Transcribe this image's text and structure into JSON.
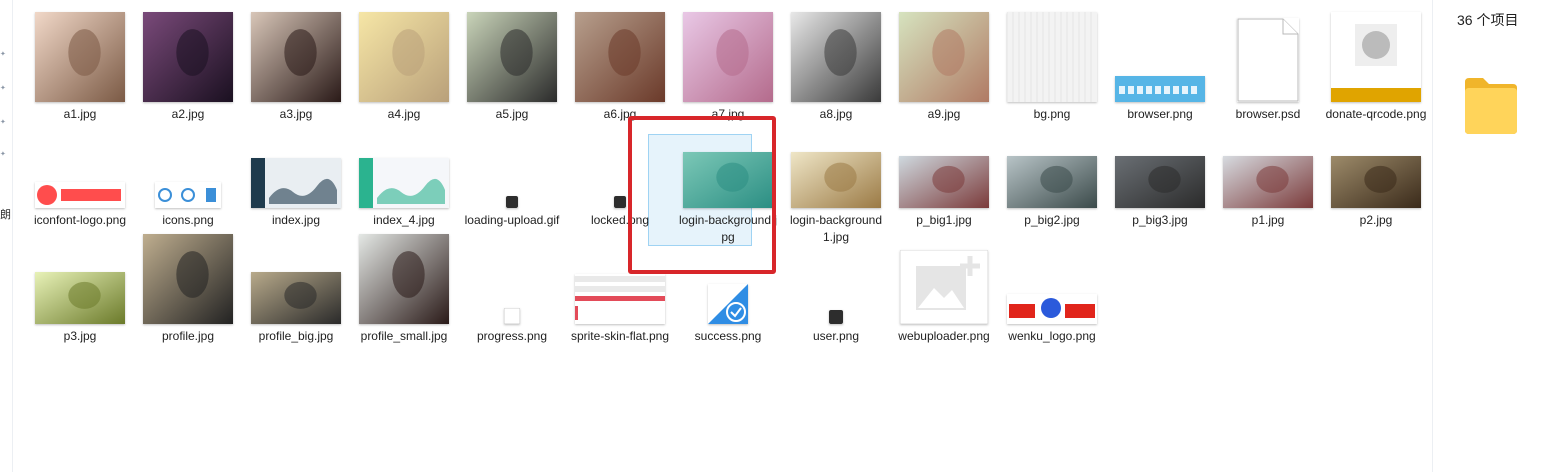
{
  "status": {
    "item_count": "36 个项目"
  },
  "left_strip": {
    "char": "朗"
  },
  "files": [
    {
      "name": "a1.jpg",
      "kind": "photo",
      "colors": [
        "#f1d8c8",
        "#7b5a45"
      ]
    },
    {
      "name": "a2.jpg",
      "kind": "photo",
      "colors": [
        "#7a4a7a",
        "#1a1020"
      ]
    },
    {
      "name": "a3.jpg",
      "kind": "photo",
      "colors": [
        "#d8c6b8",
        "#2a1a18"
      ]
    },
    {
      "name": "a4.jpg",
      "kind": "photo",
      "colors": [
        "#f6e6a6",
        "#b9a07a"
      ]
    },
    {
      "name": "a5.jpg",
      "kind": "photo",
      "colors": [
        "#c9d4b9",
        "#2b2b2b"
      ]
    },
    {
      "name": "a6.jpg",
      "kind": "photo",
      "colors": [
        "#b79f8d",
        "#6b3a2a"
      ]
    },
    {
      "name": "a7.jpg",
      "kind": "photo",
      "colors": [
        "#e9c8e6",
        "#b46b8c"
      ]
    },
    {
      "name": "a8.jpg",
      "kind": "photo",
      "colors": [
        "#e8e8e8",
        "#3a3a3a"
      ]
    },
    {
      "name": "a9.jpg",
      "kind": "photo",
      "colors": [
        "#d6e3bf",
        "#b07a64"
      ]
    },
    {
      "name": "bg.png",
      "kind": "pattern",
      "colors": [
        "#f3f3f3",
        "#e6e6e6"
      ]
    },
    {
      "name": "browser.png",
      "kind": "banner",
      "colors": [
        "#56b5e6",
        "#ffffff"
      ]
    },
    {
      "name": "browser.psd",
      "kind": "document",
      "colors": [
        "#ffffff",
        "#bdbdbd"
      ]
    },
    {
      "name": "donate-qrcode.png",
      "kind": "qrcode",
      "colors": [
        "#ffffff",
        "#e0a400"
      ]
    },
    {
      "name": "iconfont-logo.png",
      "kind": "logo-iconfont",
      "colors": [
        "#ff4d4d",
        "#ffffff"
      ]
    },
    {
      "name": "icons.png",
      "kind": "icons",
      "colors": [
        "#3b8fd8",
        "#ffffff"
      ]
    },
    {
      "name": "index.jpg",
      "kind": "dashboard",
      "colors": [
        "#1f3b4d",
        "#e9eef2"
      ]
    },
    {
      "name": "index_4.jpg",
      "kind": "dashboard",
      "colors": [
        "#2bb38f",
        "#f5f7fa"
      ]
    },
    {
      "name": "loading-upload.gif",
      "kind": "small-icon",
      "colors": [
        "#2d2d2d",
        "#ffffff"
      ]
    },
    {
      "name": "locked.png",
      "kind": "small-icon",
      "colors": [
        "#2d2d2d",
        "#ffffff"
      ]
    },
    {
      "name": "login-background.jpg",
      "kind": "landscape",
      "colors": [
        "#7cc8b7",
        "#2b8e83"
      ]
    },
    {
      "name": "login-background1.jpg",
      "kind": "landscape",
      "colors": [
        "#efe6c7",
        "#9b7a45"
      ]
    },
    {
      "name": "p_big1.jpg",
      "kind": "photo-wide",
      "colors": [
        "#cfd9df",
        "#7b3a3a"
      ]
    },
    {
      "name": "p_big2.jpg",
      "kind": "photo-wide",
      "colors": [
        "#b8c4c7",
        "#3b4a4a"
      ]
    },
    {
      "name": "p_big3.jpg",
      "kind": "photo-wide",
      "colors": [
        "#6a6f74",
        "#2b2b2b"
      ]
    },
    {
      "name": "p1.jpg",
      "kind": "photo-wide",
      "colors": [
        "#d7dbe0",
        "#7b3a3a"
      ]
    },
    {
      "name": "p2.jpg",
      "kind": "photo-wide",
      "colors": [
        "#9d8b6a",
        "#3a2a1a"
      ]
    },
    {
      "name": "p3.jpg",
      "kind": "photo-wide",
      "colors": [
        "#e8f2b8",
        "#6b7a2a"
      ]
    },
    {
      "name": "profile.jpg",
      "kind": "photo",
      "colors": [
        "#bfae8f",
        "#222222"
      ]
    },
    {
      "name": "profile_big.jpg",
      "kind": "photo-wide",
      "colors": [
        "#b8aa8b",
        "#2a2a2a"
      ]
    },
    {
      "name": "profile_small.jpg",
      "kind": "photo",
      "colors": [
        "#e4e8e5",
        "#2a1a18"
      ]
    },
    {
      "name": "progress.png",
      "kind": "tiny",
      "colors": [
        "#ffffff",
        "#cfcfcf"
      ]
    },
    {
      "name": "sprite-skin-flat.png",
      "kind": "sprite",
      "colors": [
        "#e9e9e9",
        "#e34b59"
      ]
    },
    {
      "name": "success.png",
      "kind": "success",
      "colors": [
        "#2f8de4",
        "#ffffff"
      ]
    },
    {
      "name": "user.png",
      "kind": "user",
      "colors": [
        "#2d2d2d",
        "#ffffff"
      ]
    },
    {
      "name": "webuploader.png",
      "kind": "placeholder",
      "colors": [
        "#e5e5e5",
        "#ffffff"
      ]
    },
    {
      "name": "wenku_logo.png",
      "kind": "baidu",
      "colors": [
        "#e1251b",
        "#2b5adb"
      ]
    }
  ],
  "selected": "login-background.jpg",
  "colors": {
    "selection_bg": "#e6f3fb",
    "selection_border": "#9fd3f3",
    "annotation": "#d8262a",
    "folder": "#f6c94b"
  }
}
